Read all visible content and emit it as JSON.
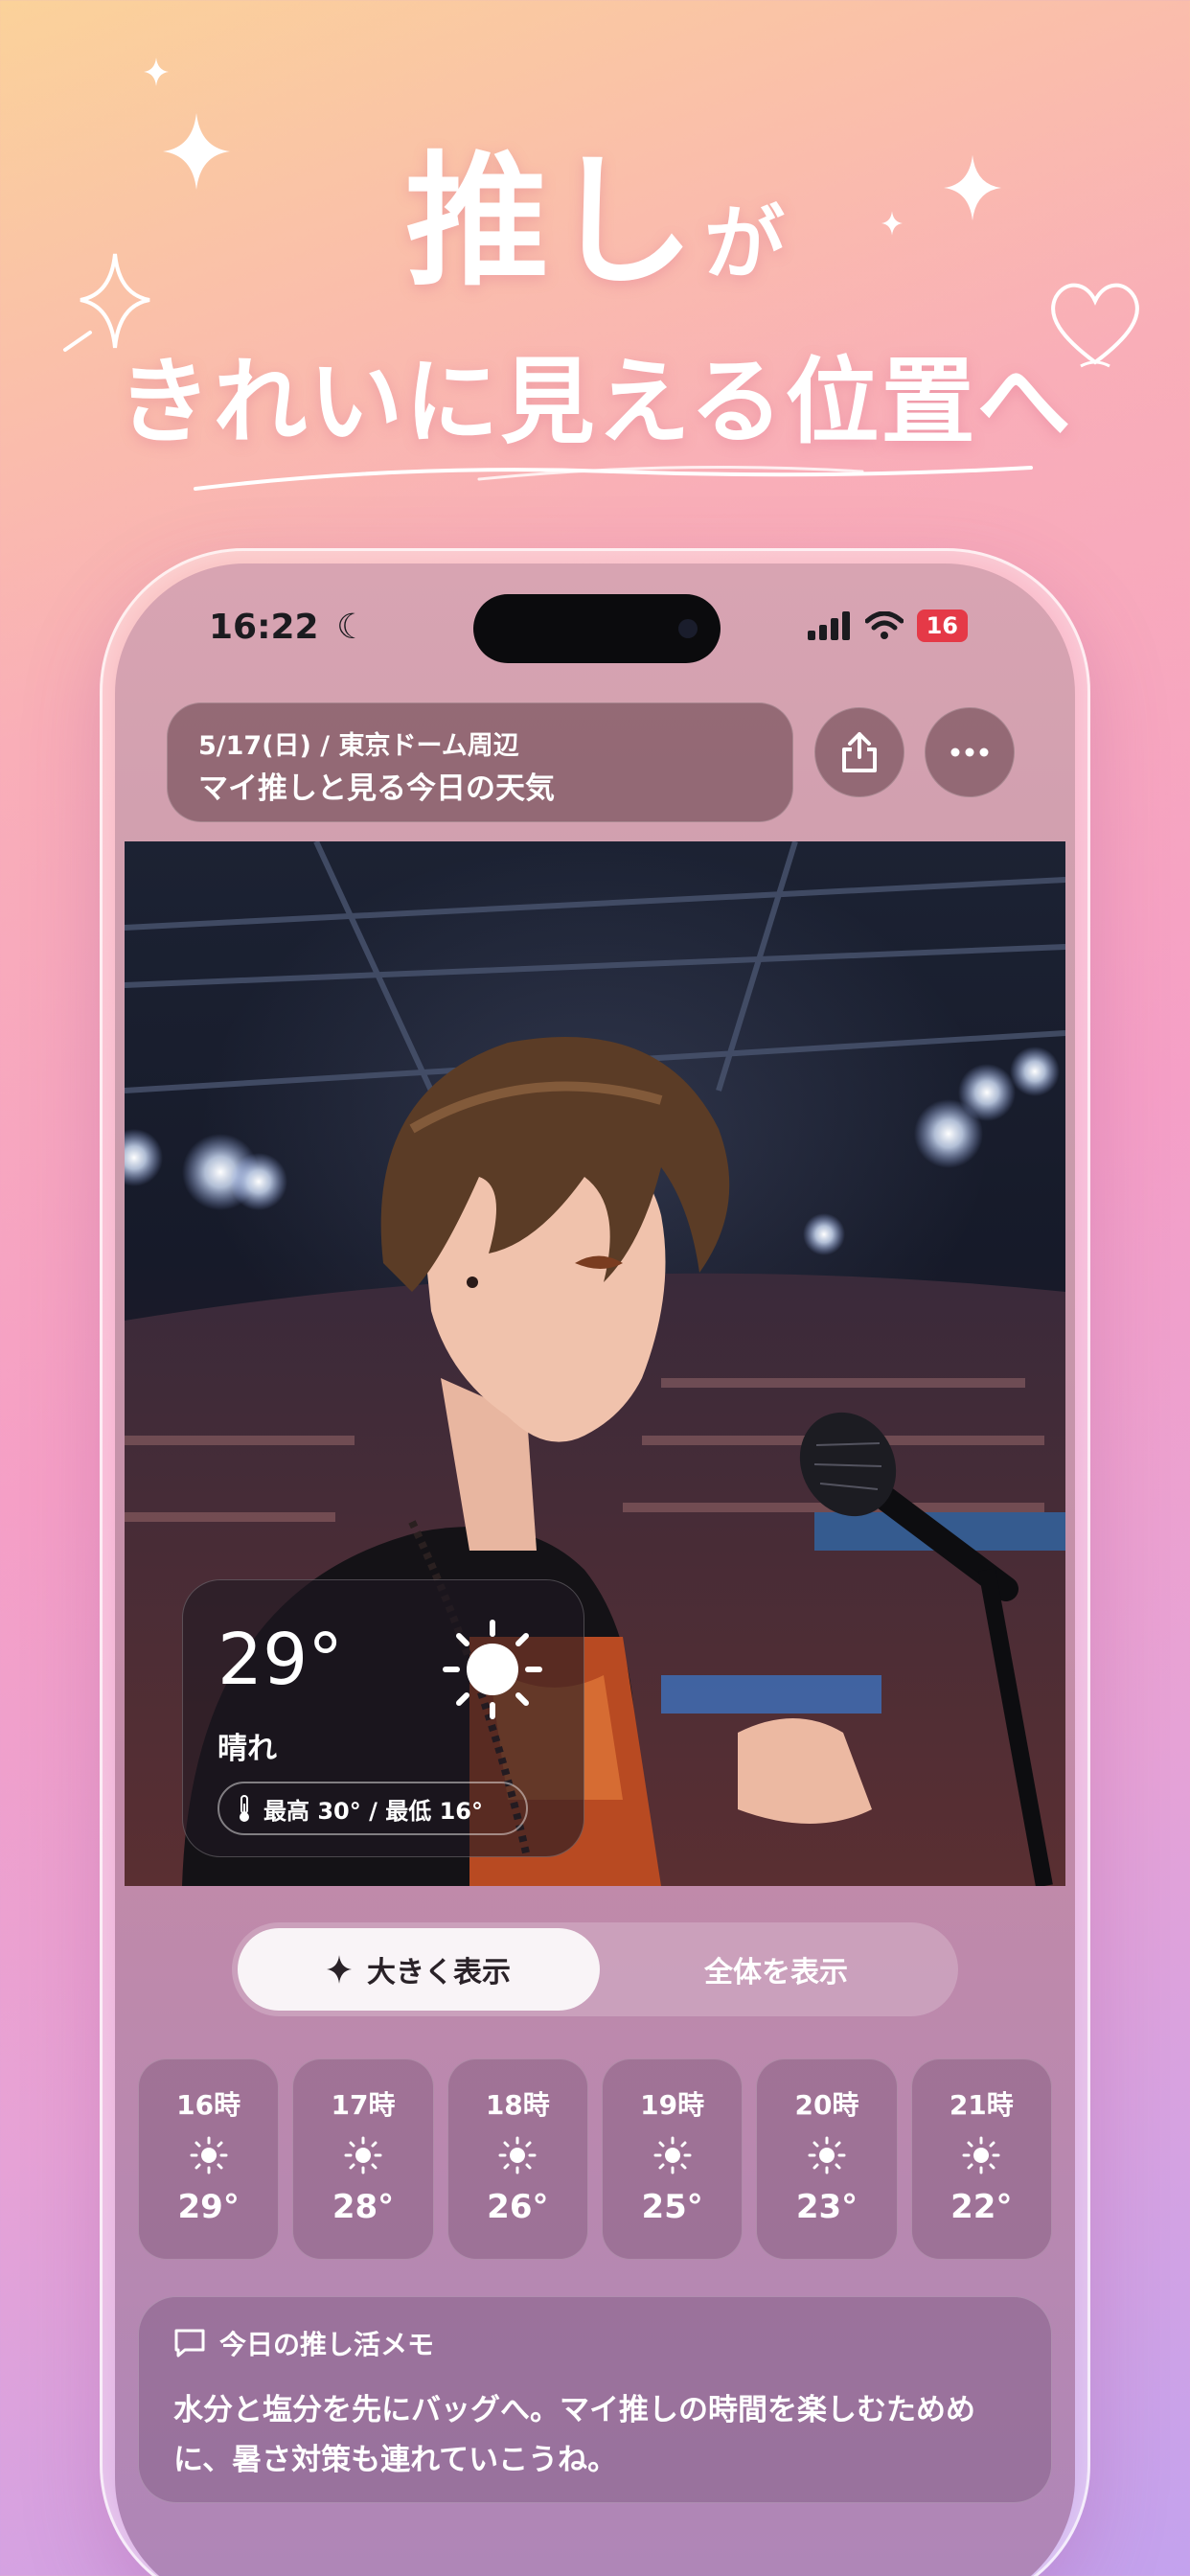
{
  "headline": {
    "line1_main": "推し",
    "line1_suffix": "が",
    "line2": "きれいに見える位置へ"
  },
  "status_bar": {
    "time": "16:22",
    "battery": "16"
  },
  "header": {
    "date_location": "5/17(日) / 東京ドーム周辺",
    "title": "マイ推しと見る今日の天気"
  },
  "weather": {
    "temperature": "29°",
    "condition": "晴れ",
    "high_low": "最高 30° / 最低 16°",
    "icon": "sun-icon"
  },
  "view_toggle": {
    "active_label": "大きく表示",
    "inactive_label": "全体を表示"
  },
  "hourly": [
    {
      "hour": "16時",
      "temp": "29°"
    },
    {
      "hour": "17時",
      "temp": "28°"
    },
    {
      "hour": "18時",
      "temp": "26°"
    },
    {
      "hour": "19時",
      "temp": "25°"
    },
    {
      "hour": "20時",
      "temp": "23°"
    },
    {
      "hour": "21時",
      "temp": "22°"
    }
  ],
  "memo": {
    "title": "今日の推し活メモ",
    "body": "水分と塩分を先にバッグへ。マイ推しの時間を楽しむためめに、暑さ対策も連れていこうね。"
  },
  "colors": {
    "battery_red": "#e53947",
    "background_top": "#fbd29a",
    "background_bottom": "#c3a2ee"
  }
}
